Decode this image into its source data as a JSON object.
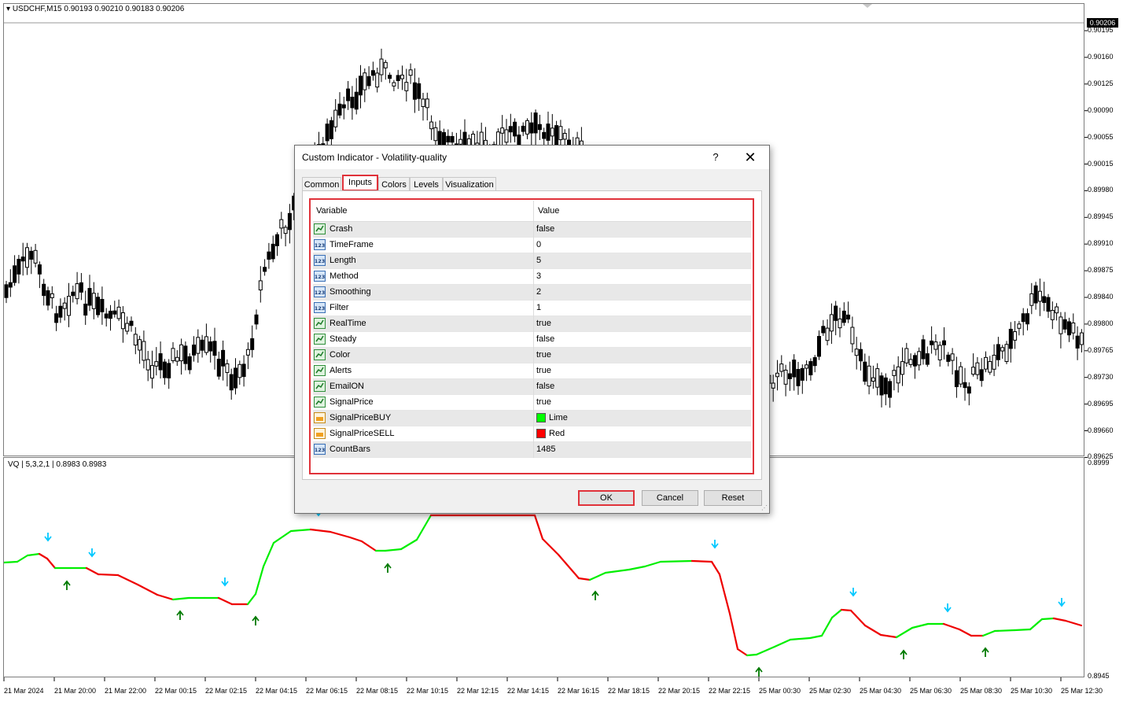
{
  "chart": {
    "title": "USDCHF,M15  0.90193 0.90210 0.90183 0.90206",
    "current_price": "0.90206",
    "price_labels": [
      "0.90195",
      "0.90160",
      "0.90125",
      "0.90090",
      "0.90055",
      "0.90015",
      "0.89980",
      "0.89945",
      "0.89910",
      "0.89875",
      "0.89840",
      "0.89800",
      "0.89765",
      "0.89730",
      "0.89695",
      "0.89660",
      "0.89625"
    ],
    "subwindow_title": "VQ | 5,3,2,1 | 0.8983 0.8983",
    "subwindow_labels": [
      "0.8999",
      "0.8945"
    ],
    "time_labels": [
      "21 Mar 2024",
      "21 Mar 20:00",
      "21 Mar 22:00",
      "22 Mar 00:15",
      "22 Mar 02:15",
      "22 Mar 04:15",
      "22 Mar 06:15",
      "22 Mar 08:15",
      "22 Mar 10:15",
      "22 Mar 12:15",
      "22 Mar 14:15",
      "22 Mar 16:15",
      "22 Mar 18:15",
      "22 Mar 20:15",
      "22 Mar 22:15",
      "25 Mar 00:30",
      "25 Mar 02:30",
      "25 Mar 04:30",
      "25 Mar 06:30",
      "25 Mar 08:30",
      "25 Mar 10:30",
      "25 Mar 12:30"
    ],
    "colors": {
      "up_line": "#00ee00",
      "down_line": "#ee0000",
      "buy_arrow": "#007a00",
      "sell_arrow": "#00c8ff",
      "candle": "#000000"
    }
  },
  "dialog": {
    "title": "Custom Indicator - Volatility-quality",
    "help": "?",
    "close": "✕",
    "tabs": [
      "Common",
      "Inputs",
      "Colors",
      "Levels",
      "Visualization"
    ],
    "active_tab": "Inputs",
    "columns": [
      "Variable",
      "Value"
    ],
    "rows": [
      {
        "icon": "bool-icon",
        "name": "Crash",
        "value": "false"
      },
      {
        "icon": "int-icon",
        "name": "TimeFrame",
        "value": "0"
      },
      {
        "icon": "int-icon",
        "name": "Length",
        "value": "5"
      },
      {
        "icon": "int-icon",
        "name": "Method",
        "value": "3"
      },
      {
        "icon": "int-icon",
        "name": "Smoothing",
        "value": "2"
      },
      {
        "icon": "int-icon",
        "name": "Filter",
        "value": "1"
      },
      {
        "icon": "bool-icon",
        "name": "RealTime",
        "value": "true"
      },
      {
        "icon": "bool-icon",
        "name": "Steady",
        "value": "false"
      },
      {
        "icon": "bool-icon",
        "name": "Color",
        "value": "true"
      },
      {
        "icon": "bool-icon",
        "name": "Alerts",
        "value": "true"
      },
      {
        "icon": "bool-icon",
        "name": "EmailON",
        "value": "false"
      },
      {
        "icon": "bool-icon",
        "name": "SignalPrice",
        "value": "true"
      },
      {
        "icon": "color-icon",
        "name": "SignalPriceBUY",
        "value": "Lime",
        "swatch": "#00ff00"
      },
      {
        "icon": "color-icon",
        "name": "SignalPriceSELL",
        "value": "Red",
        "swatch": "#ff0000"
      },
      {
        "icon": "int-icon",
        "name": "CountBars",
        "value": "1485"
      }
    ],
    "buttons": {
      "ok": "OK",
      "cancel": "Cancel",
      "reset": "Reset"
    }
  }
}
